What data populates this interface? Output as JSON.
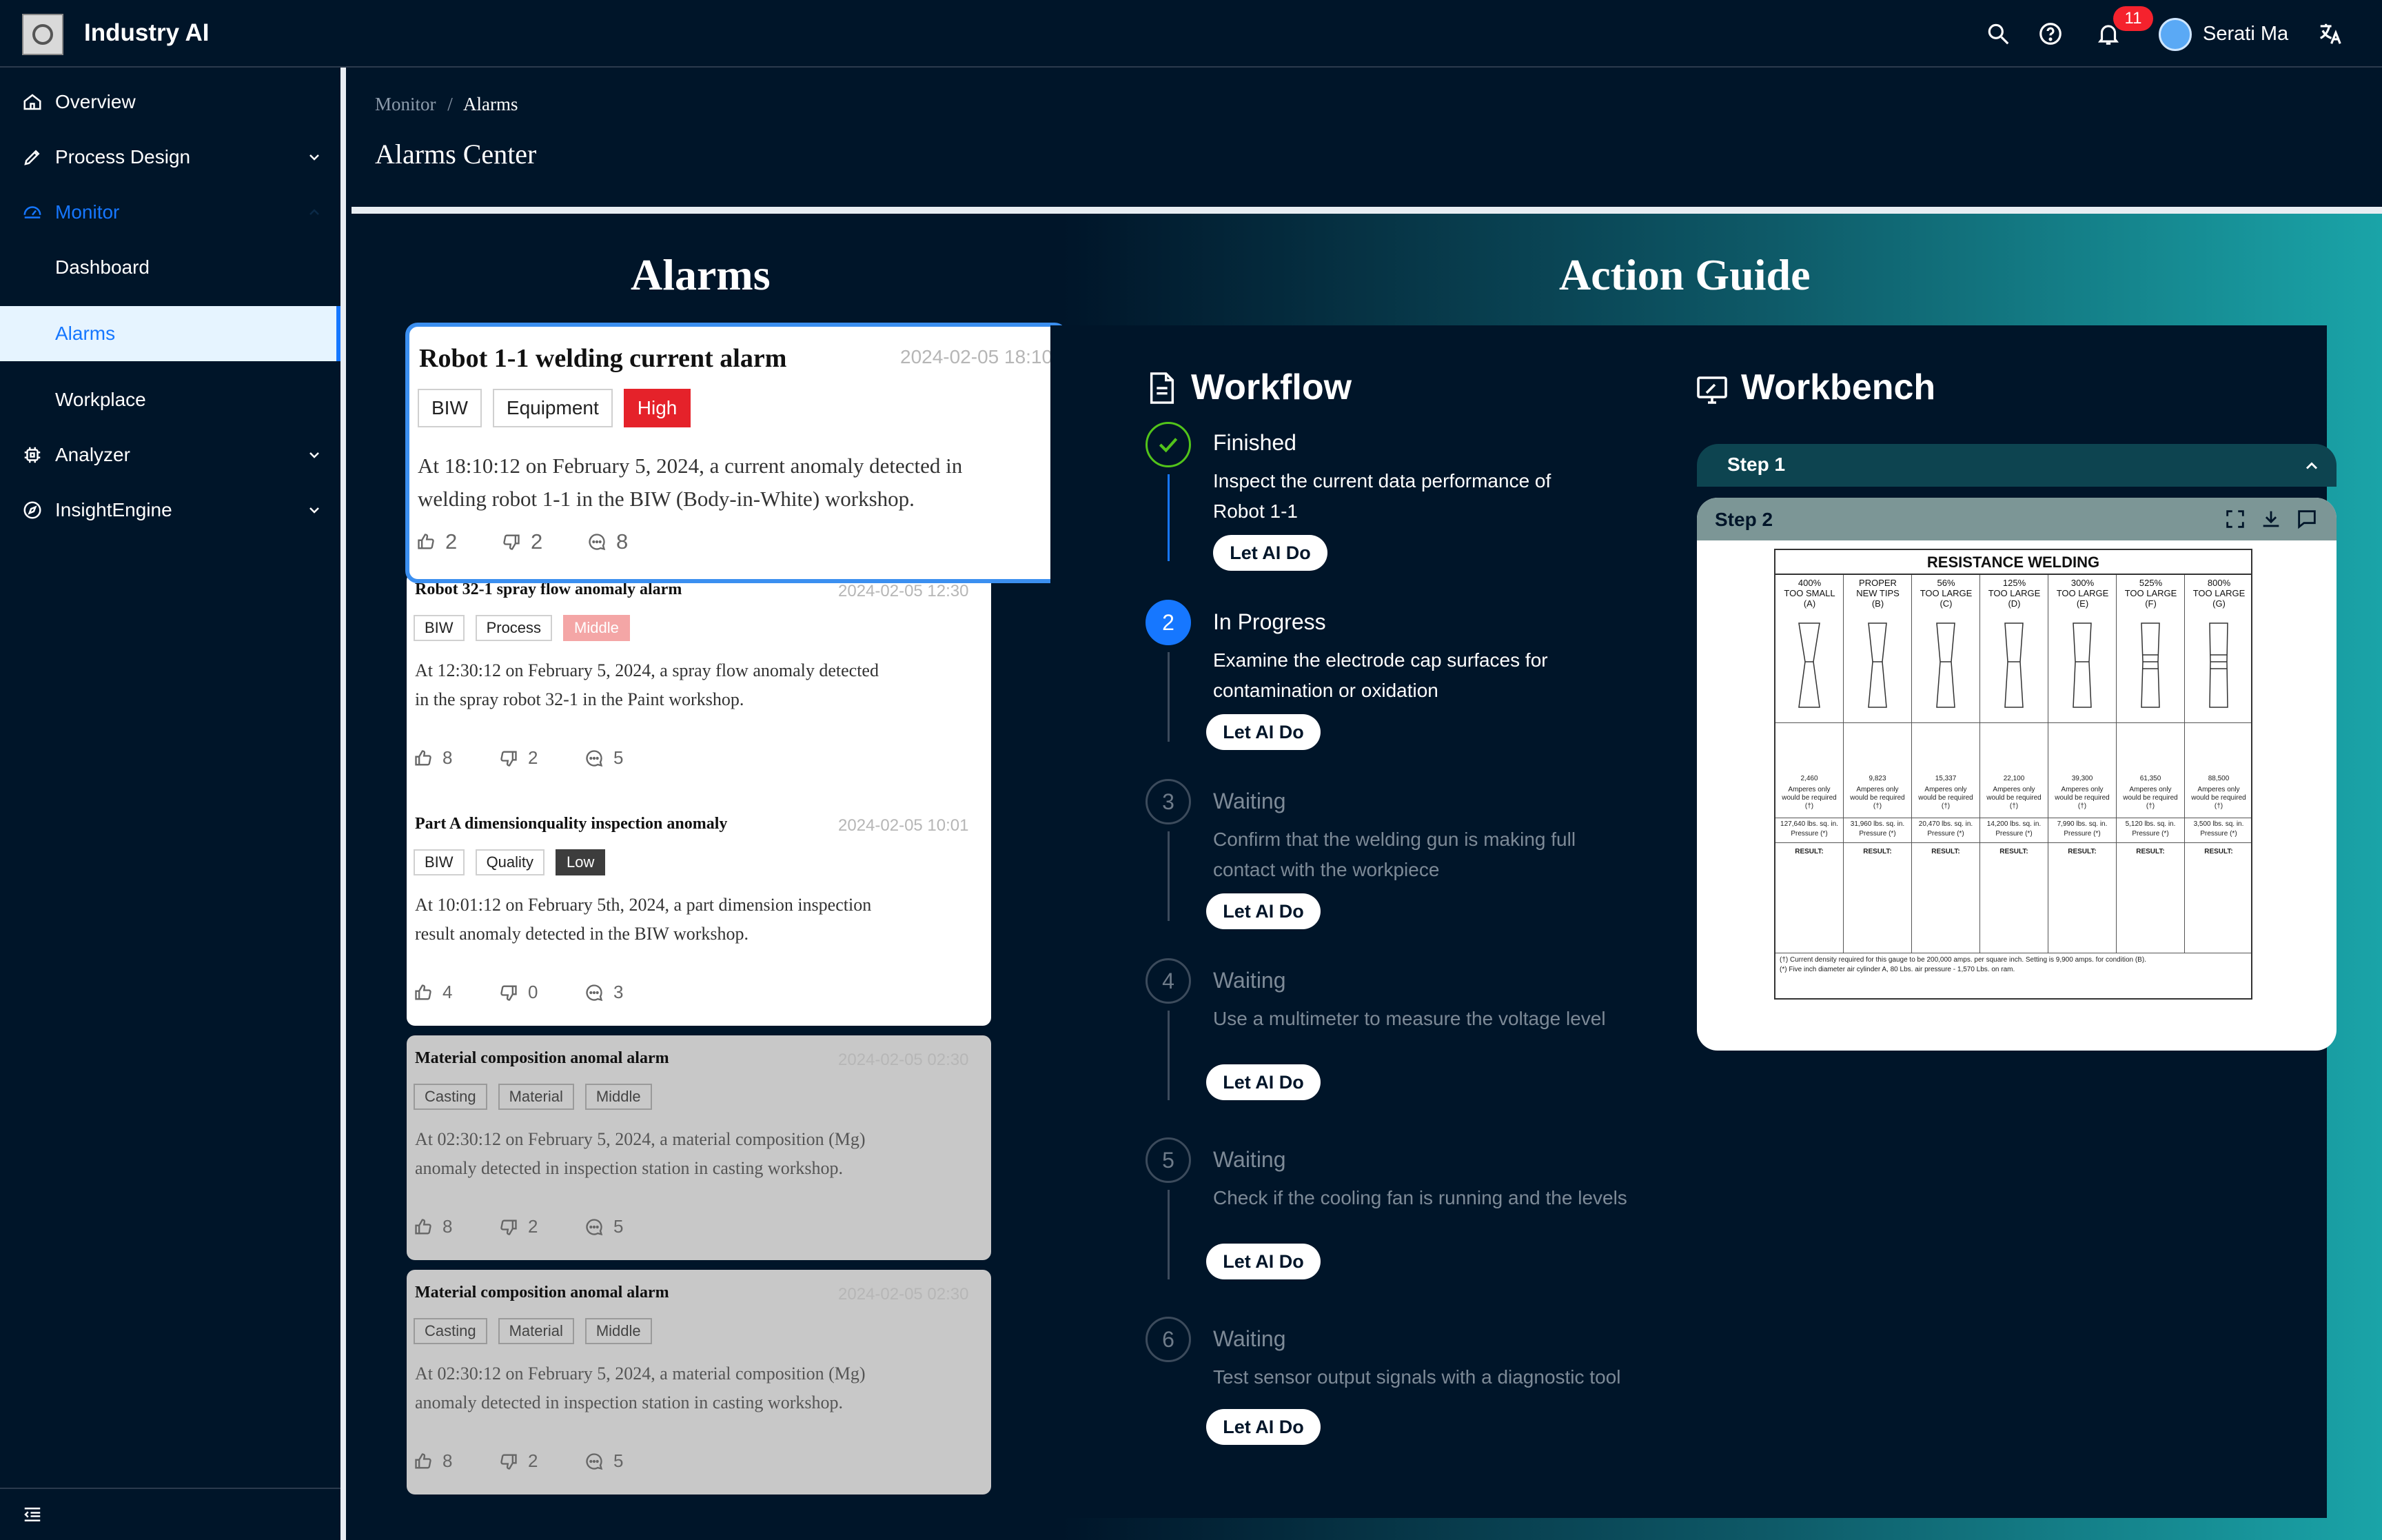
{
  "app": {
    "title": "Industry AI"
  },
  "header": {
    "notification_count": "11",
    "user_name": "Serati Ma"
  },
  "sidebar": {
    "items": [
      {
        "label": "Overview",
        "icon": "home-icon"
      },
      {
        "label": "Process Design",
        "icon": "pen-icon",
        "expandable": true
      },
      {
        "label": "Monitor",
        "icon": "dashboard-icon",
        "expanded": true
      },
      {
        "label": "Dashboard"
      },
      {
        "label": "Alarms",
        "active": true
      },
      {
        "label": "Workplace"
      },
      {
        "label": "Analyzer",
        "icon": "chip-icon",
        "expandable": true
      },
      {
        "label": "InsightEngine",
        "icon": "compass-icon",
        "expandable": true
      }
    ]
  },
  "breadcrumb": {
    "parent": "Monitor",
    "separator": "/",
    "current": "Alarms"
  },
  "page": {
    "title": "Alarms Center"
  },
  "sections": {
    "alarms": "Alarms",
    "guide": "Action Guide"
  },
  "alarms": [
    {
      "title": "Robot 1-1 welding current alarm",
      "time": "2024-02-05 18:10",
      "tags": [
        "BIW",
        "Equipment",
        "High"
      ],
      "desc_line1": "At 18:10:12 on February 5, 2024, a  current anomaly detected in",
      "desc_line2": "welding robot 1-1 in the BIW (Body-in-White) workshop.",
      "likes": "2",
      "dislikes": "2",
      "comments": "8"
    },
    {
      "title": "Robot 32-1 spray flow anomaly alarm",
      "time": "2024-02-05 12:30",
      "tags": [
        "BIW",
        "Process",
        "Middle"
      ],
      "desc_line1": "At 12:30:12 on February 5, 2024,  a spray flow anomaly detected",
      "desc_line2": "in the spray robot 32-1 in the Paint workshop.",
      "likes": "8",
      "dislikes": "2",
      "comments": "5"
    },
    {
      "title": "Part A dimensionquality inspection anomaly",
      "time": "2024-02-05 10:01",
      "tags": [
        "BIW",
        "Quality",
        "Low"
      ],
      "desc_line1": "At 10:01:12 on February 5th, 2024, a part dimension inspection",
      "desc_line2": "result anomaly detected in the BIW workshop.",
      "likes": "4",
      "dislikes": "0",
      "comments": "3"
    },
    {
      "title": "Material composition anomal alarm",
      "time": "2024-02-05 02:30",
      "tags": [
        "Casting",
        "Material",
        "Middle"
      ],
      "desc_line1": "At 02:30:12 on February 5, 2024, a material composition (Mg)",
      "desc_line2": "anomaly detected in  inspection station in casting workshop.",
      "likes": "8",
      "dislikes": "2",
      "comments": "5"
    },
    {
      "title": "Material composition anomal alarm",
      "time": "2024-02-05 02:30",
      "tags": [
        "Casting",
        "Material",
        "Middle"
      ],
      "desc_line1": "At 02:30:12 on February 5, 2024, a material composition (Mg)",
      "desc_line2": "anomaly detected in  inspection station in casting workshop.",
      "likes": "8",
      "dislikes": "2",
      "comments": "5"
    }
  ],
  "workflow": {
    "title": "Workflow",
    "button_label": "Let AI Do",
    "steps": [
      {
        "num": "",
        "status": "Finished",
        "line1": "Inspect the current data performance of",
        "line2": "Robot 1-1"
      },
      {
        "num": "2",
        "status": "In Progress",
        "line1": "Examine the electrode cap surfaces for",
        "line2": "contamination or oxidation"
      },
      {
        "num": "3",
        "status": "Waiting",
        "line1": "Confirm that the welding gun is making full",
        "line2": "contact with the workpiece"
      },
      {
        "num": "4",
        "status": "Waiting",
        "line1": "Use a multimeter to measure the voltage level",
        "line2": ""
      },
      {
        "num": "5",
        "status": "Waiting",
        "line1": "Check if the cooling fan is running and the  levels",
        "line2": ""
      },
      {
        "num": "6",
        "status": "Waiting",
        "line1": "Test sensor output signals with a diagnostic tool",
        "line2": ""
      }
    ]
  },
  "workbench": {
    "title": "Workbench",
    "step1": "Step 1",
    "step2": "Step 2",
    "sheet_title": "RESISTANCE WELDING",
    "columns": [
      {
        "h1": "400%",
        "h2": "TOO SMALL",
        "h3": "(A)",
        "amps": "2,460",
        "press": "127,640 lbs. sq. in."
      },
      {
        "h1": "PROPER",
        "h2": "NEW TIPS",
        "h3": "(B)",
        "amps": "9,823",
        "press": "31,960 lbs. sq. in."
      },
      {
        "h1": "56%",
        "h2": "TOO LARGE",
        "h3": "(C)",
        "amps": "15,337",
        "press": "20,470 lbs. sq. in."
      },
      {
        "h1": "125%",
        "h2": "TOO LARGE",
        "h3": "(D)",
        "amps": "22,100",
        "press": "14,200 lbs. sq. in."
      },
      {
        "h1": "300%",
        "h2": "TOO LARGE",
        "h3": "(E)",
        "amps": "39,300",
        "press": "7,990 lbs. sq. in."
      },
      {
        "h1": "525%",
        "h2": "TOO LARGE",
        "h3": "(F)",
        "amps": "61,350",
        "press": "5,120 lbs. sq. in."
      },
      {
        "h1": "800%",
        "h2": "TOO LARGE",
        "h3": "(G)",
        "amps": "88,500",
        "press": "3,500 lbs. sq. in."
      }
    ],
    "amps_label": "Amperes only would be required (†)",
    "press_label": "Pressure (*)",
    "result_label": "RESULT:",
    "footnote1": "(†) Current density required for this gauge to be 200,000 amps. per square inch. Setting is 9,900 amps. for condition (B).",
    "footnote2": "(*) Five inch diameter air cylinder A, 80 Lbs. air pressure - 1,570 Lbs. on ram."
  }
}
